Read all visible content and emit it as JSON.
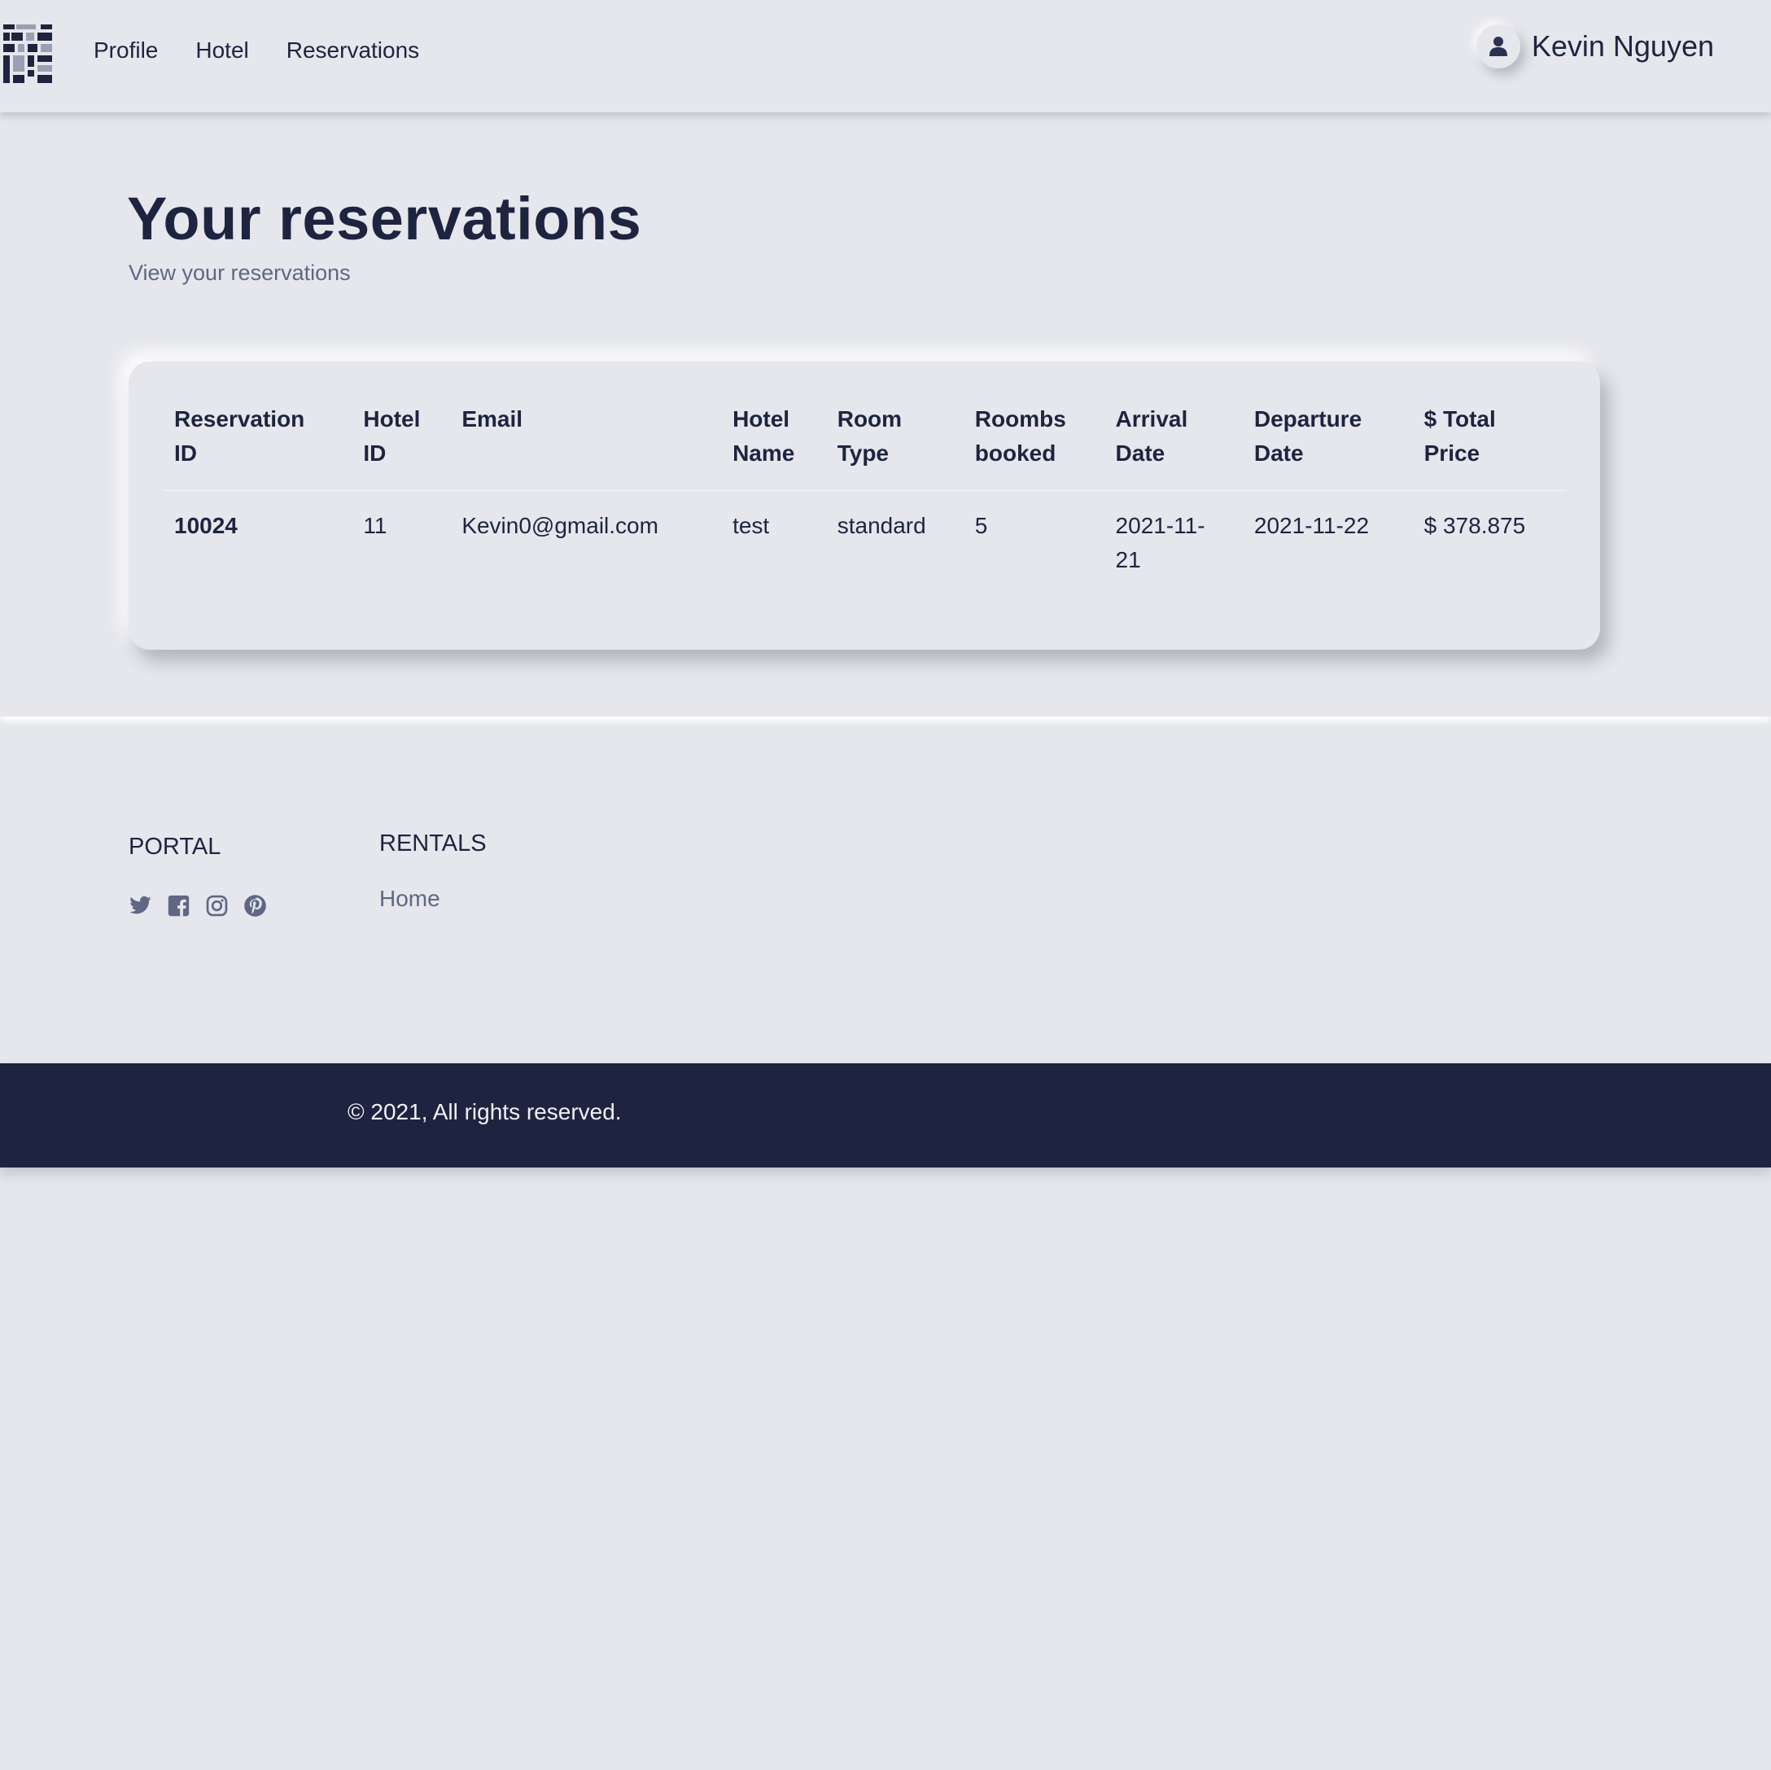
{
  "header": {
    "nav": [
      "Profile",
      "Hotel",
      "Reservations"
    ],
    "user_name": "Kevin Nguyen"
  },
  "page": {
    "title": "Your reservations",
    "subtitle": "View your reservations"
  },
  "table": {
    "columns": [
      [
        "Reservation",
        "ID"
      ],
      [
        "Hotel",
        "ID"
      ],
      [
        "Email",
        ""
      ],
      [
        "Hotel",
        "Name"
      ],
      [
        "Room",
        "Type"
      ],
      [
        "Roombs",
        "booked"
      ],
      [
        "Arrival",
        "Date"
      ],
      [
        "Departure",
        "Date"
      ],
      [
        "$ Total",
        "Price"
      ]
    ],
    "rows": [
      {
        "reservation_id": "10024",
        "hotel_id": "11",
        "email": "Kevin0@gmail.com",
        "hotel_name": "test",
        "room_type": "standard",
        "rooms_booked": "5",
        "arrival_date": [
          "2021-11-",
          "21"
        ],
        "departure_date": "2021-11-22",
        "total_price": "$ 378.875"
      }
    ]
  },
  "footer": {
    "portal_title": "PORTAL",
    "social_icons": [
      "twitter-icon",
      "facebook-icon",
      "instagram-icon",
      "pinterest-icon"
    ],
    "rentals_title": "RENTALS",
    "rentals_links": [
      "Home"
    ],
    "copyright": "© 2021, All rights reserved."
  },
  "colors": {
    "background": "#e6e7ec",
    "primary_text": "#1e2440",
    "muted_text": "#5f6785",
    "footer_bar": "#1e2440"
  }
}
